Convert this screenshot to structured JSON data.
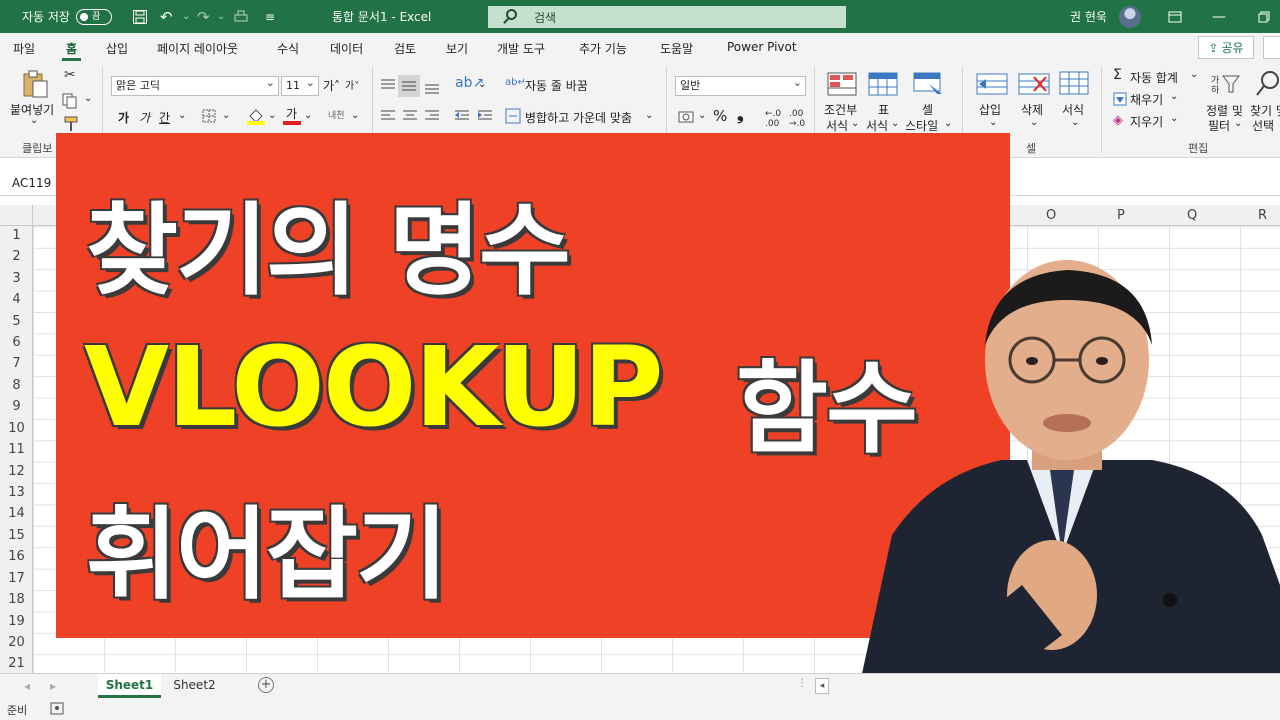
{
  "titlebar": {
    "autosave_label": "자동 저장",
    "autosave_state": "끔",
    "doc_title": "통합 문서1  -  Excel",
    "search_placeholder": "검색",
    "user_name": "권 현욱"
  },
  "menu": {
    "tabs": [
      "파일",
      "홈",
      "삽입",
      "페이지 레이아웃",
      "수식",
      "데이터",
      "검토",
      "보기",
      "개발 도구",
      "추가 기능",
      "도움말",
      "Power Pivot"
    ],
    "share_label": "공유"
  },
  "ribbon": {
    "clipboard": {
      "paste_label": "붙여넣기",
      "group_label": "클립보"
    },
    "font": {
      "name": "맑은 고딕",
      "size": "11",
      "grow": "가˄",
      "shrink": "가˅",
      "bold": "가",
      "italic": "가",
      "underline": "간",
      "ext": "내천"
    },
    "alignment": {
      "wrap_label": "자동 줄 바꿈",
      "merge_label": "병합하고 가운데 맞춤"
    },
    "number": {
      "format": "일반",
      "percent": "%",
      "comma": "❟"
    },
    "styles": {
      "conditional_label_1": "조건부",
      "conditional_label_2": "서식",
      "table_label_1": "표",
      "table_label_2": "서식",
      "cell_label_1": "셀",
      "cell_label_2": "스타일"
    },
    "cells": {
      "insert_label": "삽입",
      "delete_label": "삭제",
      "format_label": "서식",
      "group_label": "셀"
    },
    "editing": {
      "autosum_label": "자동 합계",
      "fill_label": "채우기",
      "clear_label": "지우기",
      "sort_label_1": "정렬 및",
      "sort_label_2": "필터",
      "find_label_1": "찾기 및",
      "find_label_2": "선택",
      "group_label": "편집"
    }
  },
  "formula_bar": {
    "name_box": "AC119"
  },
  "columns": [
    "O",
    "P",
    "Q",
    "R"
  ],
  "rows": [
    "1",
    "2",
    "3",
    "4",
    "5",
    "6",
    "7",
    "8",
    "9",
    "10",
    "11",
    "12",
    "13",
    "14",
    "15",
    "16",
    "17",
    "18",
    "19",
    "20",
    "21"
  ],
  "thumbnail": {
    "line1": "찾기의 명수",
    "line2_accent": "VLOOKUP",
    "line2_rest": "함수",
    "line3": "휘어잡기",
    "bg_color": "#ee4125",
    "accent_color": "#ffff00"
  },
  "sheets": [
    "Sheet1",
    "Sheet2"
  ],
  "status": {
    "ready": "준비"
  }
}
